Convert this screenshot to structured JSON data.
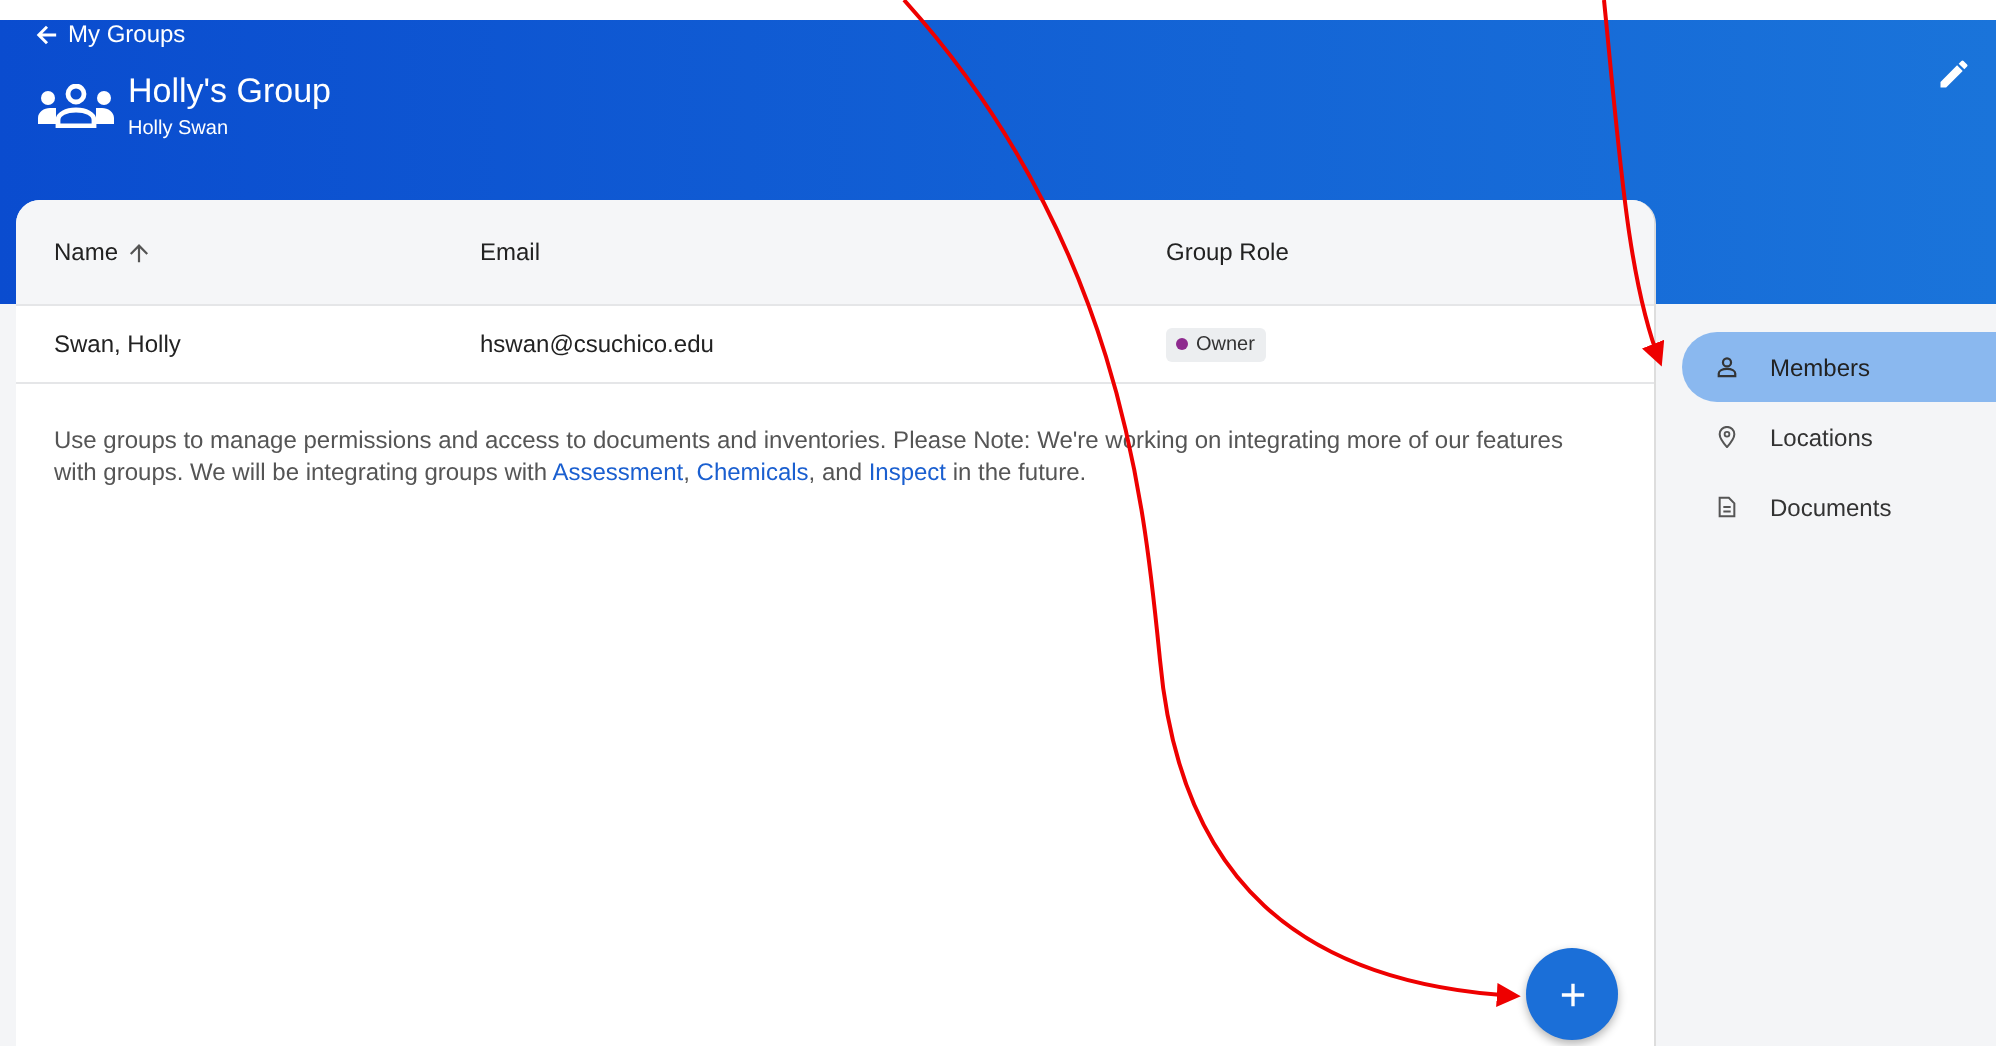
{
  "header": {
    "back_link": "My Groups",
    "title": "Holly's Group",
    "subtitle": "Holly Swan"
  },
  "table": {
    "columns": [
      {
        "label": "Name",
        "sorted": true
      },
      {
        "label": "Email",
        "sorted": false
      },
      {
        "label": "Group Role",
        "sorted": false
      }
    ],
    "rows": [
      {
        "name": "Swan, Holly",
        "email": "hswan@csuchico.edu",
        "role": {
          "label": "Owner",
          "color": "#8e2a8e"
        }
      }
    ]
  },
  "note": [
    {
      "kind": "text",
      "text": "Use groups to manage permissions and access to documents and inventories. Please Note: We're working on integrating more of our features with groups. We will be integrating groups with "
    },
    {
      "kind": "link",
      "text": "Assessment"
    },
    {
      "kind": "text",
      "text": ", "
    },
    {
      "kind": "link",
      "text": "Chemicals"
    },
    {
      "kind": "text",
      "text": ", and "
    },
    {
      "kind": "link",
      "text": "Inspect"
    },
    {
      "kind": "text",
      "text": " in the future."
    }
  ],
  "sidebar": {
    "items": [
      {
        "label": "Members",
        "kind": "person",
        "selected": true
      },
      {
        "label": "Locations",
        "kind": "pin",
        "selected": false
      },
      {
        "label": "Documents",
        "kind": "document",
        "selected": false
      }
    ]
  }
}
